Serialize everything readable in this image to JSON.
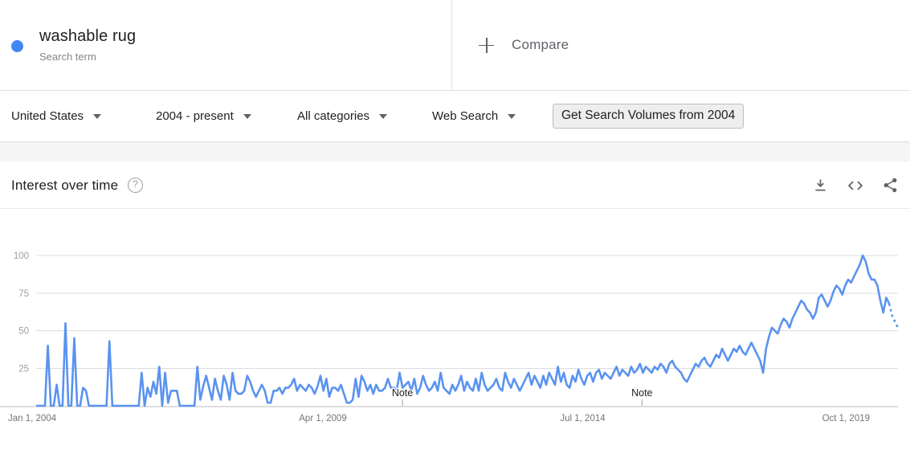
{
  "term": {
    "name": "washable rug",
    "subtitle": "Search term",
    "dot_color": "#4285f4"
  },
  "compare": {
    "label": "Compare",
    "icon": "plus-icon"
  },
  "filters": {
    "country": "United States",
    "time_range": "2004 - present",
    "category": "All categories",
    "search_type": "Web Search",
    "volumes_button": "Get Search Volumes from 2004"
  },
  "card": {
    "title": "Interest over time",
    "help_icon": "?",
    "actions": [
      {
        "name": "download-icon",
        "title": "Download"
      },
      {
        "name": "embed-icon",
        "title": "Embed"
      },
      {
        "name": "share-icon",
        "title": "Share"
      }
    ]
  },
  "chart_data": {
    "type": "line",
    "title": "Interest over time",
    "xlabel": "",
    "ylabel": "",
    "ylim": [
      0,
      100
    ],
    "yticks": [
      25,
      50,
      75,
      100
    ],
    "grid": true,
    "legend": false,
    "xticks": [
      "Jan 1, 2004",
      "Apr 1, 2009",
      "Jul 1, 2014",
      "Oct 1, 2019"
    ],
    "xtick_positions": [
      0,
      0.305,
      0.608,
      0.912
    ],
    "annotations": [
      {
        "label": "Note",
        "x_fraction": 0.425
      },
      {
        "label": "Note",
        "x_fraction": 0.703
      }
    ],
    "series": [
      {
        "name": "washable rug",
        "color": "#5a93f0",
        "partial_tail_points": 3,
        "values": [
          0,
          0,
          0,
          0,
          40,
          0,
          0,
          14,
          0,
          0,
          55,
          0,
          0,
          45,
          0,
          0,
          12,
          10,
          0,
          0,
          0,
          0,
          0,
          0,
          0,
          43,
          0,
          0,
          0,
          0,
          0,
          0,
          0,
          0,
          0,
          0,
          22,
          0,
          12,
          6,
          16,
          8,
          26,
          0,
          22,
          2,
          10,
          10,
          10,
          0,
          0,
          0,
          0,
          0,
          0,
          26,
          4,
          13,
          20,
          12,
          4,
          18,
          10,
          4,
          20,
          14,
          4,
          22,
          10,
          8,
          8,
          10,
          20,
          16,
          10,
          6,
          10,
          14,
          10,
          2,
          2,
          10,
          10,
          12,
          8,
          12,
          12,
          14,
          18,
          10,
          14,
          12,
          10,
          14,
          12,
          8,
          13,
          20,
          10,
          18,
          6,
          12,
          12,
          10,
          14,
          8,
          2,
          2,
          4,
          18,
          6,
          20,
          16,
          10,
          14,
          8,
          14,
          10,
          10,
          12,
          18,
          12,
          12,
          10,
          22,
          12,
          14,
          16,
          10,
          18,
          8,
          12,
          20,
          14,
          10,
          12,
          16,
          10,
          22,
          12,
          10,
          8,
          14,
          10,
          14,
          20,
          10,
          16,
          12,
          10,
          18,
          10,
          22,
          14,
          10,
          12,
          14,
          18,
          12,
          10,
          22,
          16,
          12,
          18,
          14,
          10,
          14,
          18,
          22,
          14,
          20,
          16,
          12,
          20,
          14,
          22,
          18,
          14,
          26,
          16,
          22,
          14,
          12,
          20,
          16,
          24,
          18,
          14,
          20,
          22,
          16,
          22,
          24,
          18,
          22,
          20,
          18,
          22,
          26,
          20,
          24,
          22,
          20,
          26,
          22,
          24,
          28,
          22,
          26,
          24,
          22,
          26,
          24,
          28,
          26,
          22,
          28,
          30,
          26,
          24,
          22,
          18,
          16,
          20,
          24,
          28,
          26,
          30,
          32,
          28,
          26,
          30,
          34,
          32,
          38,
          34,
          30,
          34,
          38,
          36,
          40,
          36,
          34,
          38,
          42,
          38,
          34,
          30,
          22,
          38,
          46,
          52,
          50,
          48,
          54,
          58,
          56,
          52,
          58,
          62,
          66,
          70,
          68,
          64,
          62,
          58,
          62,
          72,
          74,
          70,
          66,
          70,
          76,
          80,
          78,
          74,
          80,
          84,
          82,
          86,
          90,
          94,
          100,
          96,
          88,
          84,
          84,
          80,
          70,
          62,
          72,
          68,
          60,
          56,
          52
        ]
      }
    ]
  }
}
